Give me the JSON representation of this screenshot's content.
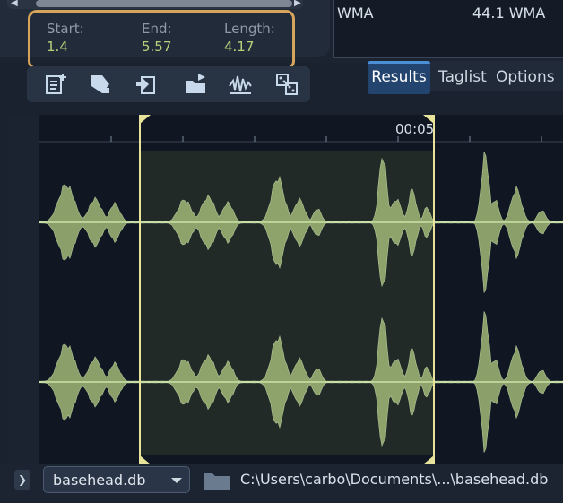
{
  "selection": {
    "start_label": "Start:",
    "start_value": "1.4",
    "end_label": "End:",
    "end_value": "5.57",
    "length_label": "Length:",
    "length_value": "4.17"
  },
  "file_info": {
    "format": "WMA",
    "format_detail": "44.1 WMA"
  },
  "toolbar": {
    "icons": [
      "new-note-icon",
      "tag-edit-icon",
      "import-icon",
      "folder-export-icon",
      "waveform-normalize-icon",
      "dice-random-icon"
    ]
  },
  "tabs": [
    {
      "label": "Results",
      "active": true
    },
    {
      "label": "Taglist",
      "active": false
    },
    {
      "label": "Options",
      "active": false
    }
  ],
  "waveform": {
    "timecode": "00:05",
    "selection_start_s": 1.4,
    "selection_end_s": 5.57,
    "colors": {
      "wave_fill": "#a9c27c",
      "wave_line": "#d8f0b4",
      "selection": "#e8e39a",
      "background": "#101722"
    }
  },
  "footer": {
    "database": "basehead.db",
    "path": "C:\\Users\\carbo\\Documents\\...\\basehead.db"
  }
}
